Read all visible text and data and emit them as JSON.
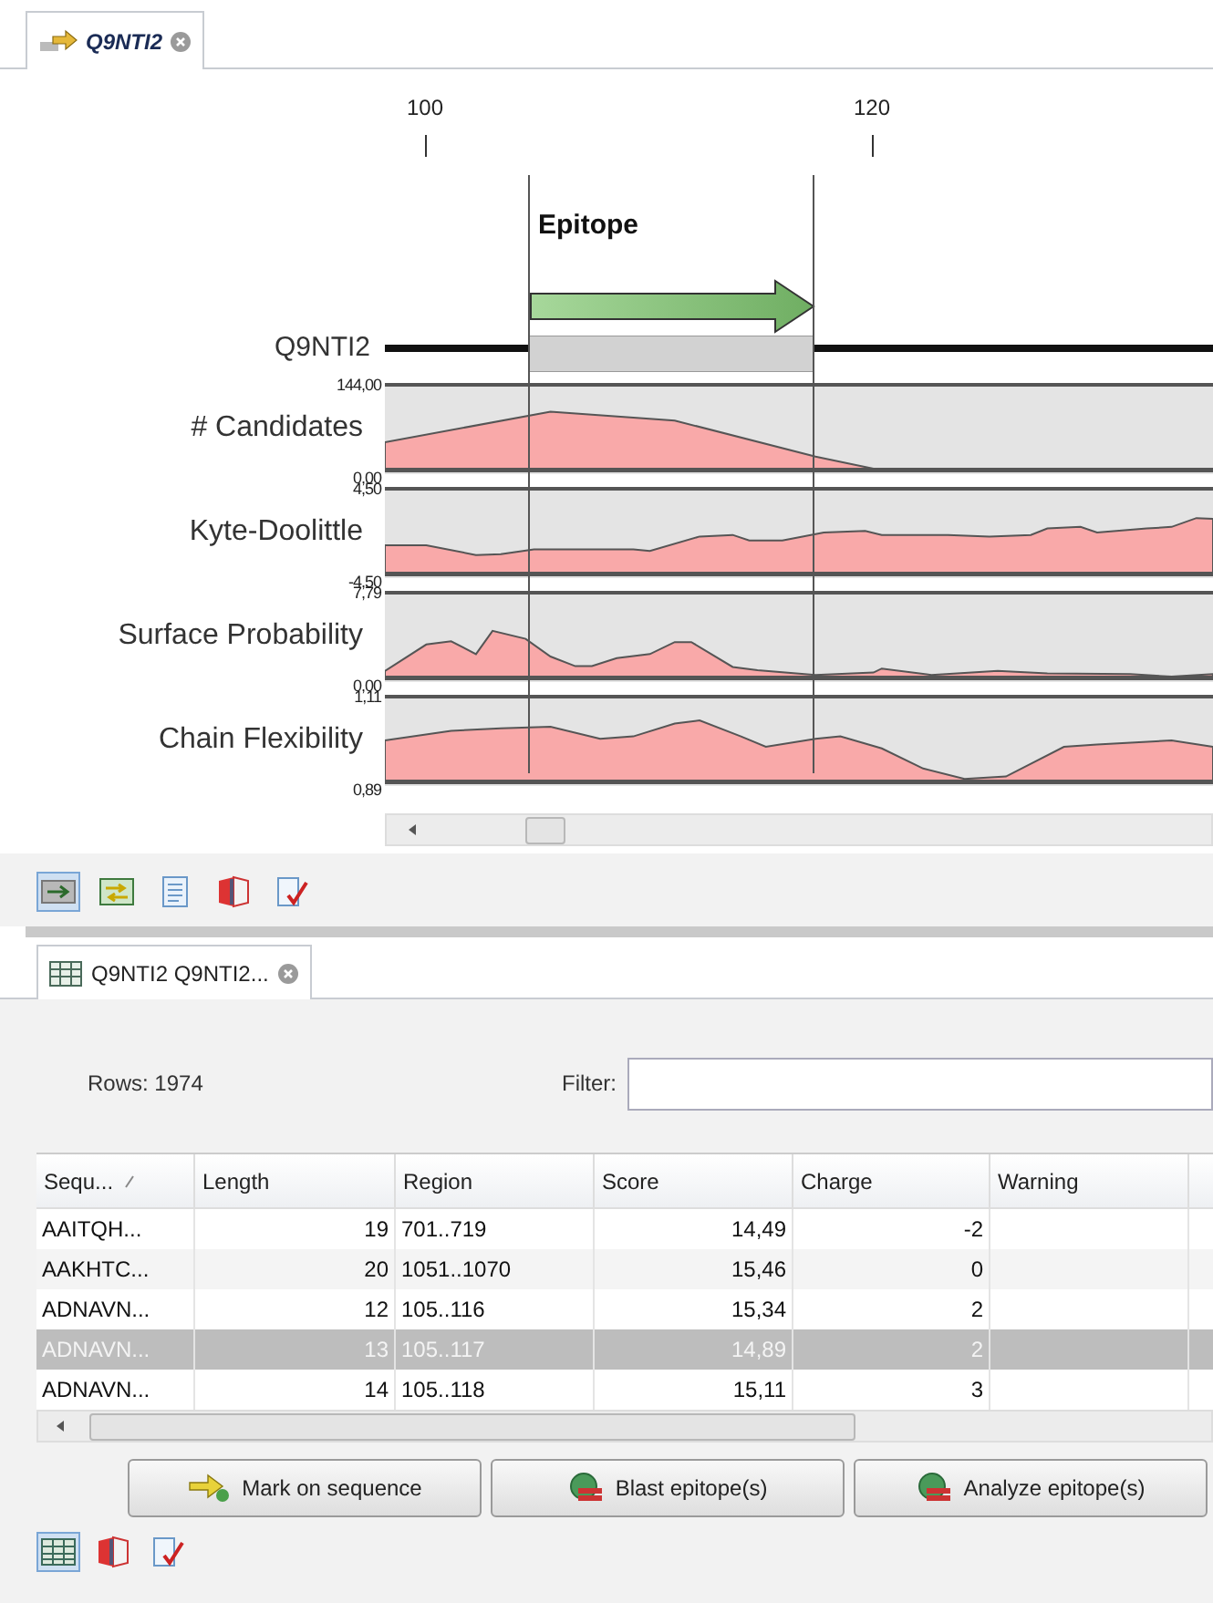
{
  "editor_tab": {
    "title": "Q9NTI2",
    "selected": true
  },
  "ruler": {
    "ticks": [
      "100",
      "120"
    ]
  },
  "annotation": {
    "label": "Epitope"
  },
  "sequence": {
    "name": "Q9NTI2"
  },
  "tracks": [
    {
      "name": "# Candidates",
      "max": "144,00",
      "min": "0,00"
    },
    {
      "name": "Kyte-Doolittle",
      "max": "4,50",
      "min": "-4,50"
    },
    {
      "name": "Surface Probability",
      "max": "7,79",
      "min": "0,00"
    },
    {
      "name": "Chain Flexibility",
      "max": "1,11",
      "min": "0,89"
    }
  ],
  "view_buttons": [
    {
      "selected": true
    },
    {
      "selected": false
    },
    {
      "selected": false
    },
    {
      "selected": false
    },
    {
      "selected": false
    }
  ],
  "table_tab": {
    "title": "Q9NTI2 Q9NTI2...",
    "selected": true
  },
  "rows_count": "Rows: 1974",
  "filter": {
    "label": "Filter:"
  },
  "table": {
    "columns": [
      "Sequ...",
      "Length",
      "Region",
      "Score",
      "Charge",
      "Warning"
    ],
    "rows": [
      {
        "cells": [
          "AAITQH...",
          "19",
          "701..719",
          "14,49",
          "-2",
          ""
        ],
        "selected": false
      },
      {
        "cells": [
          "AAKHTC...",
          "20",
          "1051..1070",
          "15,46",
          "0",
          ""
        ],
        "selected": false
      },
      {
        "cells": [
          "ADNAVN...",
          "12",
          "105..116",
          "15,34",
          "2",
          ""
        ],
        "selected": false
      },
      {
        "cells": [
          "ADNAVN...",
          "13",
          "105..117",
          "14,89",
          "2",
          ""
        ],
        "selected": true
      },
      {
        "cells": [
          "ADNAVN...",
          "14",
          "105..118",
          "15,11",
          "3",
          ""
        ],
        "selected": false
      }
    ]
  },
  "actions": [
    {
      "label": "Mark on sequence",
      "kind": "mark"
    },
    {
      "label": "Blast epitope(s)",
      "kind": "blast"
    },
    {
      "label": "Analyze epitope(s)",
      "kind": "analyze"
    }
  ],
  "bottom_view_buttons": [
    {
      "selected": true
    },
    {
      "selected": false
    },
    {
      "selected": false
    }
  ]
}
